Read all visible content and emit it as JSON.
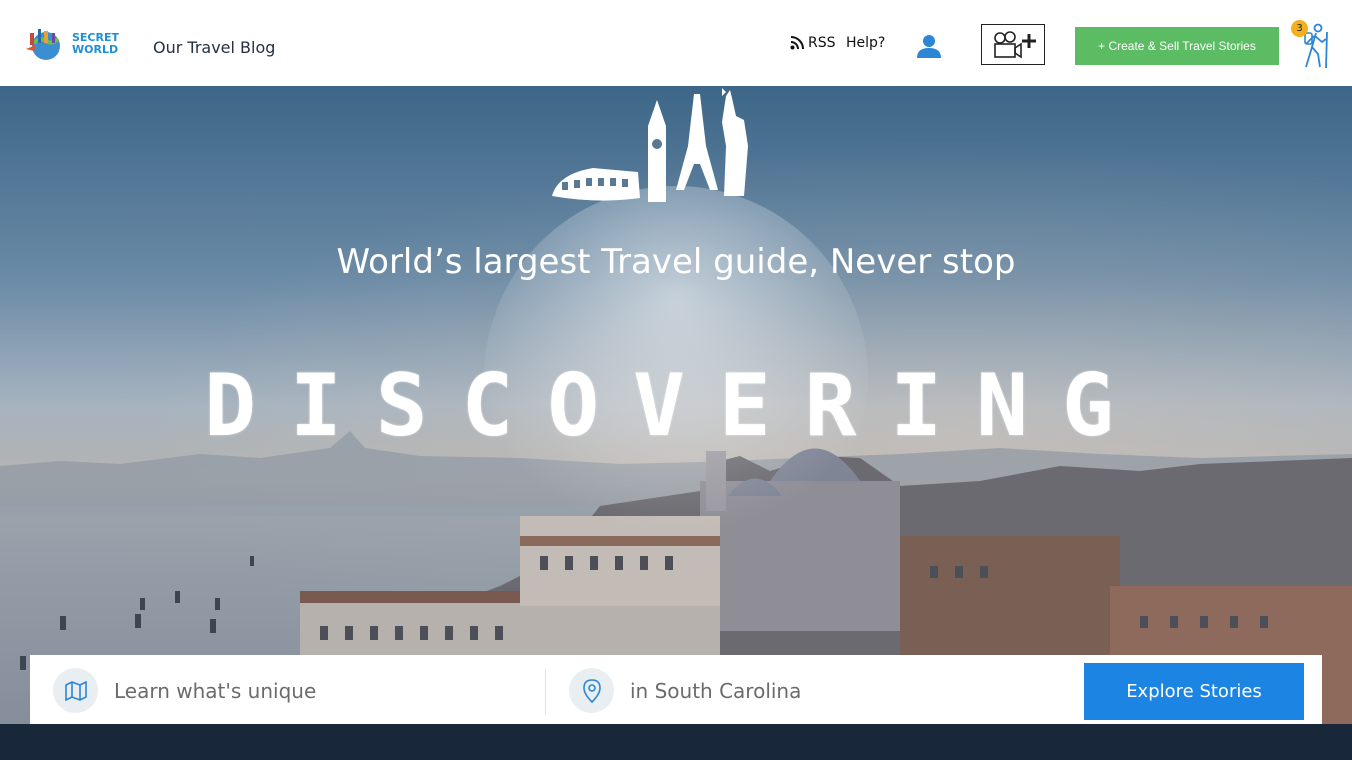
{
  "header": {
    "logo": {
      "line1": "SECRET",
      "line2": "WORLD"
    },
    "blog_link": "Our Travel Blog",
    "rss_label": "RSS",
    "help_label": "Help?",
    "create_button": "+ Create & Sell Travel Stories",
    "notification_count": "3"
  },
  "hero": {
    "tagline": "World’s largest Travel guide, Never stop",
    "headline": "DISCOVERING"
  },
  "search": {
    "what_placeholder": "Learn what's unique",
    "where_placeholder": "in South Carolina",
    "explore_button": "Explore Stories"
  },
  "colors": {
    "accent_green": "#5cbc63",
    "accent_blue": "#1c84e3",
    "badge_yellow": "#f2b01e",
    "footer_navy": "#18273a"
  },
  "icons": [
    "globe-logo-icon",
    "rss-icon",
    "user-icon",
    "video-add-icon",
    "hiker-icon",
    "map-icon",
    "location-pin-icon"
  ]
}
